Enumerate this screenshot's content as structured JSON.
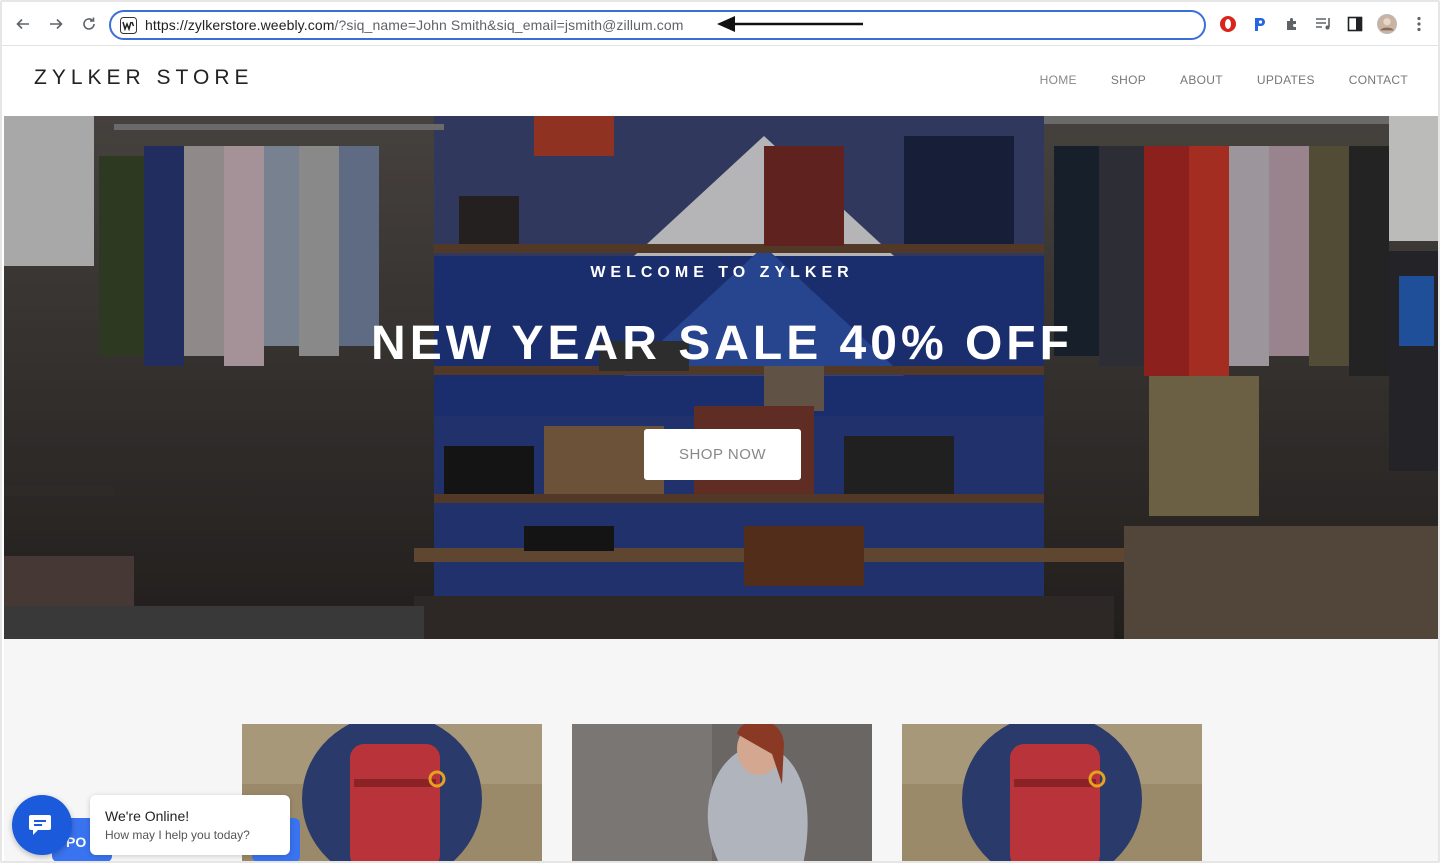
{
  "browser": {
    "url_host": "https://zylkerstore.weebly.com",
    "url_path": "/?siq_name=John Smith&siq_email=jsmith@zillum.com",
    "back_icon": "back-arrow-icon",
    "forward_icon": "forward-arrow-icon",
    "reload_icon": "reload-icon",
    "extensions": [
      "opera-extension-icon",
      "p-extension-icon",
      "puzzle-icon",
      "media-icon",
      "sidebar-icon",
      "profile-avatar",
      "kebab-menu-icon"
    ]
  },
  "site": {
    "logo": "ZYLKER STORE",
    "nav": [
      "HOME",
      "SHOP",
      "ABOUT",
      "UPDATES",
      "CONTACT"
    ]
  },
  "hero": {
    "subtitle": "WELCOME TO ZYLKER",
    "title": "NEW YEAR SALE 40% OFF",
    "button": "SHOP NOW"
  },
  "chat": {
    "title": "We're Online!",
    "text": "How may I help you today?",
    "tab_label": "PO"
  },
  "colors": {
    "omnibox_border": "#3b6fd8",
    "chat_blue": "#1a5adb",
    "hero_dark": "#3a3633"
  }
}
